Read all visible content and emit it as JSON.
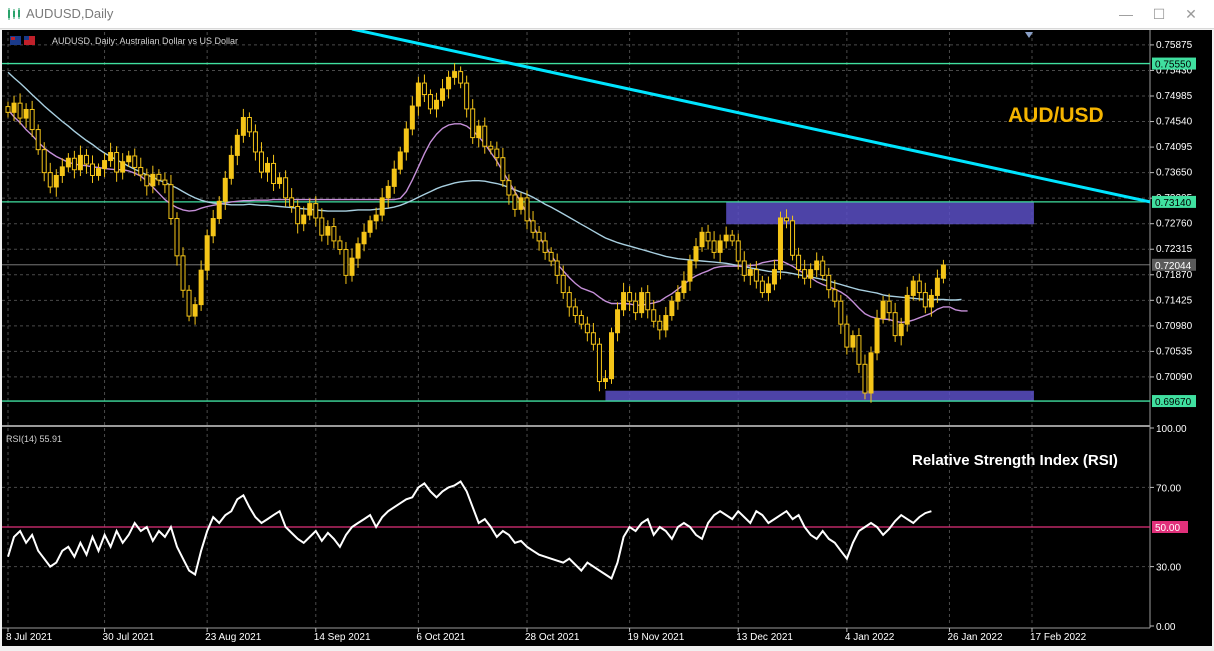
{
  "window": {
    "title": "AUDUSD,Daily",
    "minimize": "—",
    "maximize": "☐",
    "close": "✕"
  },
  "header": {
    "symbol_label": "AUDUSD, Daily:  Australian Dollar vs US Dollar"
  },
  "overlay": {
    "price_title": "AUD/USD",
    "rsi_title": "Relative Strength Index (RSI)",
    "rsi_label": "RSI(14) 55.91"
  },
  "colors": {
    "bull": "#f5c518",
    "bear": "#f5c518",
    "ma_fast": "#c58fd8",
    "ma_slow": "#a8cfe0",
    "trendline": "#00e5ff",
    "level": "#40e0a0",
    "zone": "#5b4fc4",
    "rsi_line": "#ffffff",
    "rsi_mid": "#e0307a",
    "grid": "#4a4a4a",
    "axis_text": "#ffffff"
  },
  "chart_data": [
    {
      "type": "candlestick",
      "title": "AUDUSD, Daily:  Australian Dollar vs US Dollar",
      "ylim": [
        0.6927,
        0.761
      ],
      "y_ticks": [
        "0.75875",
        "0.75430",
        "0.74985",
        "0.74540",
        "0.74095",
        "0.73650",
        "0.73205",
        "0.72760",
        "0.72315",
        "0.71870",
        "0.71425",
        "0.70980",
        "0.70535",
        "0.70090"
      ],
      "x_ticks": [
        "8 Jul 2021",
        "30 Jul 2021",
        "23 Aug 2021",
        "14 Sep 2021",
        "6 Oct 2021",
        "28 Oct 2021",
        "19 Nov 2021",
        "13 Dec 2021",
        "4 Jan 2022",
        "26 Jan 2022",
        "17 Feb 2022"
      ],
      "current_price": "0.72044",
      "levels": [
        {
          "label": "0.75550",
          "value": 0.7555
        },
        {
          "label": "0.73140",
          "value": 0.7314
        },
        {
          "label": "0.69670",
          "value": 0.6967
        }
      ],
      "zones": [
        {
          "from_bar": 119,
          "to_bar": 170,
          "low": 0.7275,
          "high": 0.7314
        },
        {
          "from_bar": 99,
          "to_bar": 170,
          "low": 0.6967,
          "high": 0.6985
        }
      ],
      "trendline": [
        {
          "bar": 57,
          "value": 0.761
        },
        {
          "bar": 170,
          "value": 0.7314
        }
      ],
      "close": [
        0.747,
        0.7486,
        0.746,
        0.7475,
        0.744,
        0.7405,
        0.7365,
        0.734,
        0.736,
        0.7375,
        0.739,
        0.737,
        0.7395,
        0.738,
        0.736,
        0.7372,
        0.7386,
        0.74,
        0.7366,
        0.7384,
        0.7394,
        0.7374,
        0.7361,
        0.7342,
        0.7362,
        0.7352,
        0.7344,
        0.7285,
        0.722,
        0.716,
        0.7115,
        0.7135,
        0.7195,
        0.7255,
        0.7285,
        0.7315,
        0.7355,
        0.7395,
        0.743,
        0.7461,
        0.7436,
        0.7401,
        0.7366,
        0.7381,
        0.7346,
        0.7356,
        0.7321,
        0.7306,
        0.7276,
        0.7291,
        0.7311,
        0.7286,
        0.7256,
        0.7271,
        0.7246,
        0.7231,
        0.7186,
        0.7216,
        0.7241,
        0.7261,
        0.7281,
        0.7291,
        0.7321,
        0.7341,
        0.7371,
        0.7401,
        0.7441,
        0.7481,
        0.7521,
        0.7501,
        0.7476,
        0.7491,
        0.7511,
        0.7531,
        0.7541,
        0.7521,
        0.7476,
        0.7426,
        0.7446,
        0.7411,
        0.7406,
        0.7391,
        0.7351,
        0.7326,
        0.7301,
        0.7321,
        0.7281,
        0.7261,
        0.7246,
        0.7226,
        0.7211,
        0.7186,
        0.7156,
        0.7131,
        0.7116,
        0.7101,
        0.7086,
        0.7066,
        0.7001,
        0.7006,
        0.7086,
        0.7126,
        0.7156,
        0.7141,
        0.7121,
        0.7156,
        0.7126,
        0.7106,
        0.7091,
        0.7116,
        0.7141,
        0.7156,
        0.7176,
        0.7211,
        0.7236,
        0.7261,
        0.7246,
        0.7226,
        0.7246,
        0.7256,
        0.7246,
        0.7211,
        0.7186,
        0.7196,
        0.7176,
        0.7156,
        0.7171,
        0.7196,
        0.7286,
        0.7281,
        0.7221,
        0.7196,
        0.7181,
        0.7196,
        0.7211,
        0.7186,
        0.7161,
        0.7141,
        0.7101,
        0.7061,
        0.7081,
        0.7031,
        0.6981,
        0.7051,
        0.7111,
        0.7141,
        0.7121,
        0.7081,
        0.7101,
        0.7151,
        0.7176,
        0.7156,
        0.7131,
        0.7151,
        0.7181,
        0.7204
      ],
      "ma_fast": [
        0.7475,
        0.7462,
        0.7452,
        0.744,
        0.743,
        0.7418,
        0.7408,
        0.74,
        0.7393,
        0.7388,
        0.7383,
        0.738,
        0.7378,
        0.7377,
        0.7375,
        0.7374,
        0.7372,
        0.7371,
        0.737,
        0.737,
        0.7368,
        0.7364,
        0.7359,
        0.735,
        0.734,
        0.7329,
        0.7318,
        0.731,
        0.7304,
        0.73,
        0.7298,
        0.7299,
        0.7303,
        0.7306,
        0.7308,
        0.731,
        0.7312,
        0.7314,
        0.7315,
        0.7316,
        0.7316,
        0.7317,
        0.7317,
        0.7317,
        0.7318,
        0.7318,
        0.7318,
        0.7318,
        0.7318,
        0.7318,
        0.7318,
        0.7318,
        0.7318,
        0.7318,
        0.7318,
        0.7318,
        0.7318,
        0.7318,
        0.7318,
        0.7318,
        0.7318,
        0.7318,
        0.7318,
        0.7318,
        0.7318,
        0.732,
        0.7332,
        0.7352,
        0.7375,
        0.7398,
        0.7418,
        0.7432,
        0.7442,
        0.7448,
        0.745,
        0.745,
        0.7446,
        0.7438,
        0.7428,
        0.7415,
        0.74,
        0.7385,
        0.7367,
        0.7349,
        0.7332,
        0.7313,
        0.7293,
        0.7272,
        0.7254,
        0.7237,
        0.7221,
        0.7206,
        0.7194,
        0.7182,
        0.7172,
        0.7164,
        0.716,
        0.7156,
        0.7148,
        0.7141,
        0.7137,
        0.7137,
        0.7137,
        0.7136,
        0.7134,
        0.7134,
        0.7136,
        0.7138,
        0.7141,
        0.7148,
        0.7154,
        0.7162,
        0.717,
        0.7179,
        0.7185,
        0.719,
        0.7194,
        0.7199,
        0.7201,
        0.7202,
        0.7202,
        0.7202,
        0.7201,
        0.7203,
        0.7204,
        0.7208,
        0.721,
        0.7212,
        0.7212,
        0.7207,
        0.7202,
        0.7195,
        0.7189,
        0.7182,
        0.7175,
        0.717,
        0.7166,
        0.7162,
        0.7157,
        0.715,
        0.714,
        0.7129,
        0.7119,
        0.7114,
        0.7111,
        0.711,
        0.7109,
        0.7106,
        0.7104,
        0.7105,
        0.7108,
        0.7112,
        0.7116,
        0.712,
        0.7127,
        0.7131,
        0.7131,
        0.7126,
        0.7124,
        0.7124
      ],
      "ma_slow": [
        0.754,
        0.753,
        0.7521,
        0.7511,
        0.7501,
        0.7491,
        0.7481,
        0.7472,
        0.7463,
        0.7454,
        0.7446,
        0.7437,
        0.7429,
        0.7421,
        0.7414,
        0.7406,
        0.7399,
        0.7393,
        0.7387,
        0.7382,
        0.7376,
        0.7371,
        0.7366,
        0.7361,
        0.7357,
        0.7352,
        0.7348,
        0.7343,
        0.7338,
        0.7332,
        0.7326,
        0.7321,
        0.7317,
        0.7314,
        0.7312,
        0.7311,
        0.731,
        0.7309,
        0.7309,
        0.7309,
        0.731,
        0.7309,
        0.7308,
        0.7308,
        0.7307,
        0.7306,
        0.7305,
        0.7304,
        0.7303,
        0.7302,
        0.7301,
        0.73,
        0.7299,
        0.7298,
        0.7298,
        0.7298,
        0.7298,
        0.7299,
        0.73,
        0.73,
        0.73,
        0.7301,
        0.7302,
        0.7303,
        0.7305,
        0.7308,
        0.7312,
        0.7317,
        0.7322,
        0.7327,
        0.7332,
        0.7337,
        0.7341,
        0.7344,
        0.7347,
        0.7349,
        0.735,
        0.7351,
        0.7351,
        0.735,
        0.7348,
        0.7346,
        0.7343,
        0.7339,
        0.7335,
        0.7331,
        0.7327,
        0.7322,
        0.7316,
        0.731,
        0.7305,
        0.7299,
        0.7293,
        0.7287,
        0.7281,
        0.7275,
        0.7269,
        0.7263,
        0.7257,
        0.7251,
        0.7247,
        0.7243,
        0.724,
        0.7237,
        0.7234,
        0.7231,
        0.7228,
        0.7225,
        0.7222,
        0.7219,
        0.7217,
        0.7215,
        0.7214,
        0.7213,
        0.7212,
        0.7211,
        0.721,
        0.7209,
        0.7208,
        0.7207,
        0.7205,
        0.7203,
        0.7201,
        0.7199,
        0.7197,
        0.7195,
        0.7193,
        0.7192,
        0.7192,
        0.7191,
        0.7189,
        0.7187,
        0.7185,
        0.7183,
        0.7181,
        0.7179,
        0.7176,
        0.7173,
        0.717,
        0.7167,
        0.7164,
        0.7161,
        0.7159,
        0.7157,
        0.7155,
        0.7152,
        0.715,
        0.7149,
        0.7148,
        0.7147,
        0.7146,
        0.7145,
        0.7144,
        0.7144,
        0.7144,
        0.7144,
        0.7143,
        0.7143,
        0.7144
      ]
    },
    {
      "type": "line",
      "title": "RSI(14) 55.91",
      "ylim": [
        0,
        100
      ],
      "y_ticks": [
        "100.00",
        "70.00",
        "30.00",
        "0.00"
      ],
      "mid_level": {
        "label": "50.00",
        "value": 50
      },
      "values": [
        35,
        45,
        48,
        42,
        46,
        38,
        34,
        30,
        32,
        38,
        40,
        35,
        42,
        36,
        45,
        38,
        46,
        40,
        48,
        42,
        46,
        52,
        48,
        50,
        43,
        48,
        45,
        50,
        40,
        34,
        28,
        26,
        38,
        48,
        55,
        52,
        56,
        58,
        64,
        66,
        60,
        55,
        52,
        54,
        56,
        58,
        50,
        47,
        44,
        42,
        45,
        48,
        43,
        47,
        44,
        40,
        46,
        50,
        52,
        54,
        56,
        50,
        55,
        58,
        60,
        62,
        64,
        65,
        70,
        72,
        68,
        65,
        68,
        70,
        71,
        73,
        68,
        60,
        52,
        54,
        50,
        45,
        48,
        46,
        42,
        43,
        40,
        38,
        36,
        35,
        34,
        33,
        32,
        34,
        31,
        28,
        32,
        30,
        28,
        26,
        24,
        32,
        45,
        50,
        48,
        52,
        54,
        46,
        50,
        48,
        44,
        50,
        52,
        50,
        46,
        44,
        52,
        56,
        58,
        56,
        54,
        58,
        55,
        52,
        58,
        56,
        52,
        54,
        56,
        58,
        54,
        56,
        50,
        46,
        44,
        48,
        44,
        42,
        38,
        34,
        42,
        48,
        50,
        52,
        50,
        46,
        49,
        53,
        56,
        54,
        52,
        55,
        57,
        58
      ],
      "last_value": 55.91
    }
  ]
}
